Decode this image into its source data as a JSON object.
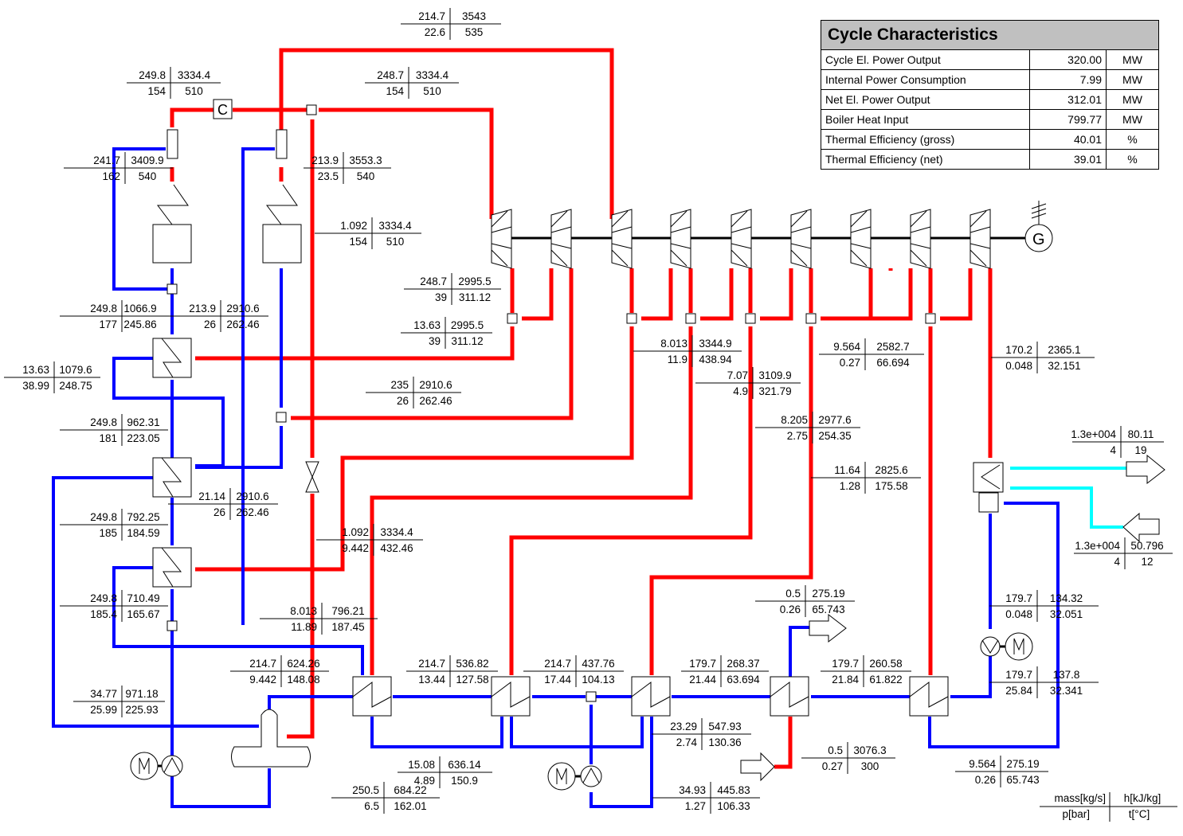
{
  "cycle_characteristics": {
    "title": "Cycle Characteristics",
    "rows": [
      {
        "label": "Cycle El. Power Output",
        "value": "320.00",
        "unit": "MW"
      },
      {
        "label": "Internal Power Consumption",
        "value": "7.99",
        "unit": "MW"
      },
      {
        "label": "Net El. Power Output",
        "value": "312.01",
        "unit": "MW"
      },
      {
        "label": "Boiler Heat Input",
        "value": "799.77",
        "unit": "MW"
      },
      {
        "label": "Thermal Efficiency (gross)",
        "value": "40.01",
        "unit": "%"
      },
      {
        "label": "Thermal Efficiency (net)",
        "value": "39.01",
        "unit": "%"
      }
    ]
  },
  "legend": {
    "mass": "mass[kg/s]",
    "enthalpy": "h[kJ/kg]",
    "pressure": "p[bar]",
    "temperature": "t[°C]"
  },
  "state_points": [
    {
      "id": "sp-main-steam-top",
      "m": "214.7",
      "h": "3543",
      "p": "22.6",
      "t": "535"
    },
    {
      "id": "sp-spray-left-out",
      "m": "249.8",
      "h": "3334.4",
      "p": "154",
      "t": "510"
    },
    {
      "id": "sp-hp-to-turbine",
      "m": "248.7",
      "h": "3334.4",
      "p": "154",
      "t": "510"
    },
    {
      "id": "sp-sh-left-out",
      "m": "241.7",
      "h": "3409.9",
      "p": "162",
      "t": "540"
    },
    {
      "id": "sp-rh-out",
      "m": "213.9",
      "h": "3553.3",
      "p": "23.5",
      "t": "540"
    },
    {
      "id": "sp-leak-hp",
      "m": "1.092",
      "h": "3334.4",
      "p": "154",
      "t": "510"
    },
    {
      "id": "sp-hp-exhaust",
      "m": "248.7",
      "h": "2995.5",
      "p": "39",
      "t": "311.12"
    },
    {
      "id": "sp-hp-extraction",
      "m": "13.63",
      "h": "2995.5",
      "p": "39",
      "t": "311.12"
    },
    {
      "id": "sp-fw-hp1-out",
      "m": "249.8",
      "h": "1066.9",
      "p": "177",
      "t": "245.86"
    },
    {
      "id": "sp-cold-reheat",
      "m": "213.9",
      "h": "2910.6",
      "p": "26",
      "t": "262.46"
    },
    {
      "id": "sp-hp1-drain",
      "m": "13.63",
      "h": "1079.6",
      "p": "38.99",
      "t": "248.75"
    },
    {
      "id": "sp-ext-2",
      "m": "235",
      "h": "2910.6",
      "p": "26",
      "t": "262.46"
    },
    {
      "id": "sp-fw-hp2-out",
      "m": "249.8",
      "h": "962.31",
      "p": "181",
      "t": "223.05"
    },
    {
      "id": "sp-hp2-steam",
      "m": "21.14",
      "h": "2910.6",
      "p": "26",
      "t": "262.46"
    },
    {
      "id": "sp-fw-hp3-out",
      "m": "249.8",
      "h": "792.25",
      "p": "185",
      "t": "184.59"
    },
    {
      "id": "sp-fw-pump-out",
      "m": "249.8",
      "h": "710.49",
      "p": "185.4",
      "t": "165.67"
    },
    {
      "id": "sp-leak-throttled",
      "m": "1.092",
      "h": "3334.4",
      "p": "9.442",
      "t": "432.46"
    },
    {
      "id": "sp-ip-ext-1",
      "m": "8.013",
      "h": "3344.9",
      "p": "11.9",
      "t": "438.94"
    },
    {
      "id": "sp-ip-ext-2",
      "m": "7.07",
      "h": "3109.9",
      "p": "4.9",
      "t": "321.79"
    },
    {
      "id": "sp-lp-ext-1",
      "m": "8.205",
      "h": "2977.6",
      "p": "2.75",
      "t": "254.35"
    },
    {
      "id": "sp-lp-ext-2",
      "m": "11.64",
      "h": "2825.6",
      "p": "1.28",
      "t": "175.58"
    },
    {
      "id": "sp-lp-ext-3",
      "m": "9.564",
      "h": "2582.7",
      "p": "0.27",
      "t": "66.694"
    },
    {
      "id": "sp-lp-exhaust",
      "m": "170.2",
      "h": "2365.1",
      "p": "0.048",
      "t": "32.151"
    },
    {
      "id": "sp-cw-out",
      "m": "1.3e+004",
      "h": "80.11",
      "p": "4",
      "t": "19"
    },
    {
      "id": "sp-cw-in",
      "m": "1.3e+004",
      "h": "50.796",
      "p": "4",
      "t": "12"
    },
    {
      "id": "sp-ip-drain",
      "m": "8.013",
      "h": "796.21",
      "p": "11.89",
      "t": "187.45"
    },
    {
      "id": "sp-hp3-drain",
      "m": "34.77",
      "h": "971.18",
      "p": "25.99",
      "t": "225.93"
    },
    {
      "id": "sp-deaerator-in",
      "m": "214.7",
      "h": "624.26",
      "p": "9.442",
      "t": "148.08"
    },
    {
      "id": "sp-lph1-out",
      "m": "214.7",
      "h": "536.82",
      "p": "13.44",
      "t": "127.58"
    },
    {
      "id": "sp-lph2-out",
      "m": "214.7",
      "h": "437.76",
      "p": "17.44",
      "t": "104.13"
    },
    {
      "id": "sp-lph3-out",
      "m": "179.7",
      "h": "268.37",
      "p": "21.44",
      "t": "63.694"
    },
    {
      "id": "sp-lph4-out",
      "m": "179.7",
      "h": "260.58",
      "p": "21.84",
      "t": "61.822"
    },
    {
      "id": "sp-condensate-out",
      "m": "179.7",
      "h": "134.32",
      "p": "0.048",
      "t": "32.051"
    },
    {
      "id": "sp-cond-pump-out",
      "m": "179.7",
      "h": "137.8",
      "p": "25.84",
      "t": "32.341"
    },
    {
      "id": "sp-lph1-drain",
      "m": "15.08",
      "h": "636.14",
      "p": "4.89",
      "t": "150.9"
    },
    {
      "id": "sp-lph2-drain",
      "m": "23.29",
      "h": "547.93",
      "p": "2.74",
      "t": "130.36"
    },
    {
      "id": "sp-drain-pump-in",
      "m": "34.93",
      "h": "445.83",
      "p": "1.27",
      "t": "106.33"
    },
    {
      "id": "sp-fw-pump-in",
      "m": "250.5",
      "h": "684.22",
      "p": "6.5",
      "t": "162.01"
    },
    {
      "id": "sp-sink-out",
      "m": "0.5",
      "h": "275.19",
      "p": "0.26",
      "t": "65.743"
    },
    {
      "id": "sp-source-in",
      "m": "0.5",
      "h": "3076.3",
      "p": "0.27",
      "t": "300"
    },
    {
      "id": "sp-lph4-drain",
      "m": "9.564",
      "h": "275.19",
      "p": "0.26",
      "t": "65.743"
    }
  ]
}
